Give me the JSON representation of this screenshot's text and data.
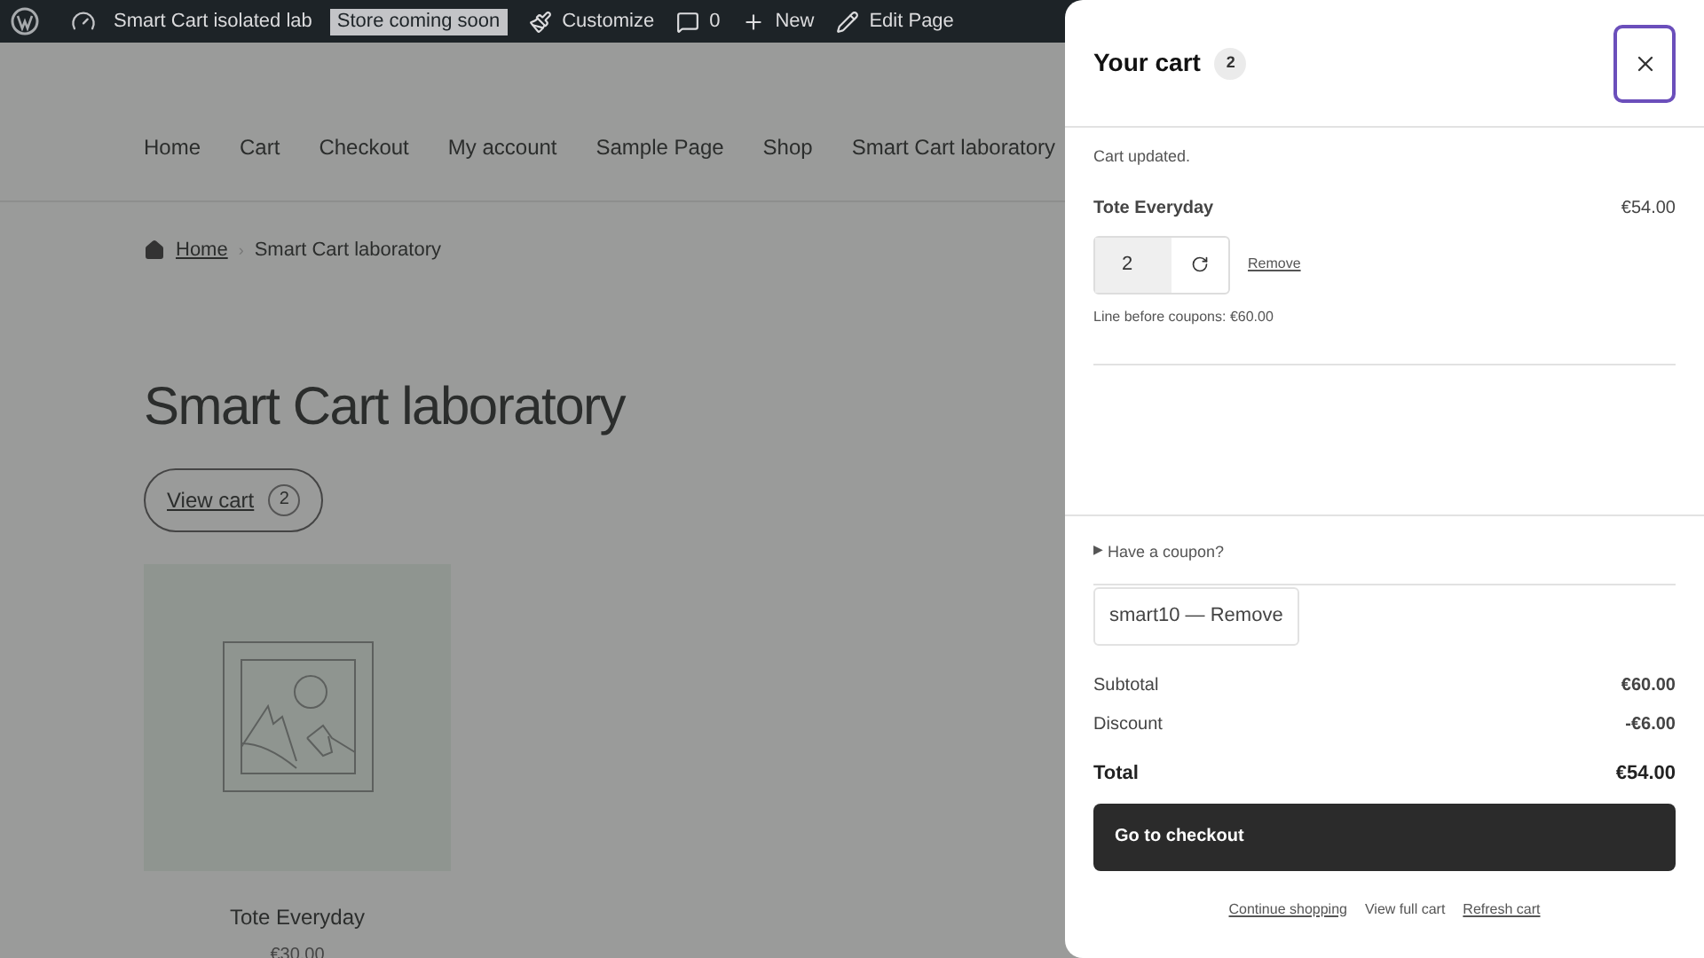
{
  "admin_bar": {
    "site_name": "Smart Cart isolated lab",
    "badge": "Store coming soon",
    "items": [
      {
        "kind": "customize",
        "label": "Customize"
      },
      {
        "kind": "comments",
        "label": "0"
      },
      {
        "kind": "new",
        "label": "New"
      },
      {
        "kind": "edit",
        "label": "Edit Page"
      }
    ]
  },
  "site": {
    "nav": [
      {
        "label": "Home"
      },
      {
        "label": "Cart"
      },
      {
        "label": "Checkout"
      },
      {
        "label": "My account"
      },
      {
        "label": "Sample Page"
      },
      {
        "label": "Shop"
      },
      {
        "label": "Smart Cart laboratory"
      }
    ]
  },
  "breadcrumb": {
    "home": "Home",
    "separator": "›",
    "current": "Smart Cart laboratory"
  },
  "page": {
    "heading": "Smart Cart laboratory",
    "view_cart": {
      "label": "View cart",
      "count": "2"
    },
    "products": [
      {
        "kind": "picture",
        "name": "Tote Everyday",
        "price": "€30.00"
      }
    ]
  },
  "cart": {
    "title": "Your cart",
    "count": "2",
    "notice": "Cart updated.",
    "items": [
      {
        "name": "Tote Everyday",
        "price": "€54.00",
        "quantity": "2",
        "remove": "Remove",
        "note": "Line before coupons: €60.00"
      }
    ],
    "coupon_toggle": {
      "icon": "▶",
      "label": "Have a coupon?",
      "expanded": false
    },
    "applied_coupon": "smart10 — Remove",
    "totals": [
      {
        "kind": "line",
        "label": "Subtotal",
        "value": "€60.00"
      },
      {
        "kind": "line",
        "label": "Discount",
        "value": "-€6.00"
      },
      {
        "kind": "total",
        "label": "Total",
        "value": "€54.00"
      }
    ],
    "checkout": "Go to checkout",
    "links": [
      {
        "label": "Continue shopping",
        "underlined": true
      },
      {
        "label": "View full cart",
        "underlined": false
      },
      {
        "label": "Refresh cart",
        "underlined": true
      }
    ]
  }
}
